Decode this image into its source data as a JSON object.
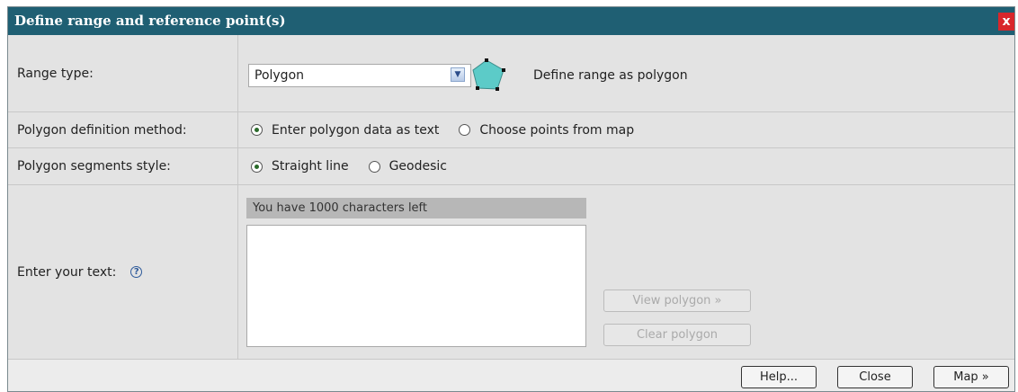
{
  "dialog": {
    "title": "Define range and reference point(s)",
    "close_glyph": "x"
  },
  "range_type": {
    "label": "Range type:",
    "selected": "Polygon",
    "description": "Define range as polygon"
  },
  "definition_method": {
    "label": "Polygon definition method:",
    "options": [
      "Enter polygon data as text",
      "Choose points from map"
    ],
    "selected_index": 0
  },
  "segments_style": {
    "label": "Polygon segments style:",
    "options": [
      "Straight line",
      "Geodesic"
    ],
    "selected_index": 0
  },
  "text_entry": {
    "label": "Enter your text:",
    "help_glyph": "?",
    "chars_left": "You have 1000 characters left",
    "value": ""
  },
  "actions": {
    "view_polygon": "View polygon »",
    "clear_polygon": "Clear polygon"
  },
  "footer": {
    "help": "Help...",
    "close": "Close",
    "map": "Map »"
  },
  "colors": {
    "titlebar": "#1f5f73",
    "close_button": "#d9262b",
    "polygon_fill": "#5ccbc8",
    "body_bg": "#e3e3e3"
  }
}
